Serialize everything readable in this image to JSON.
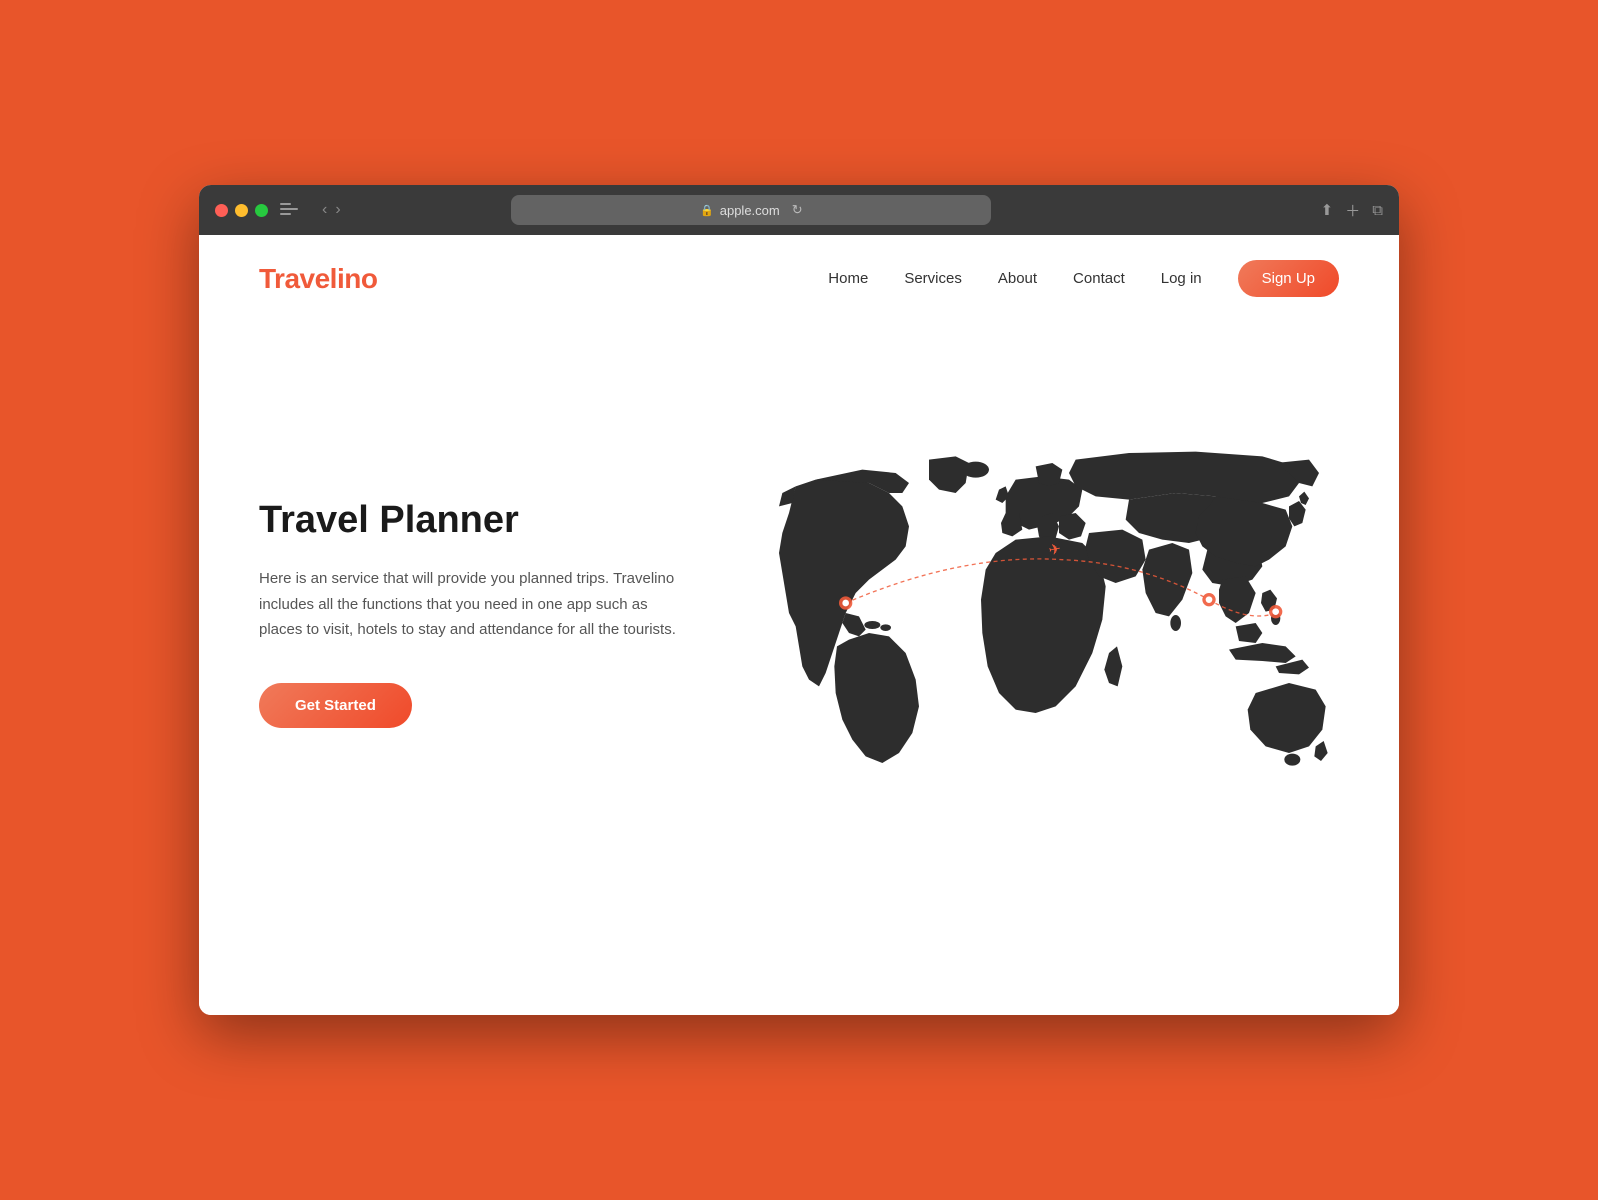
{
  "browser": {
    "url": "apple.com",
    "reload_title": "Reload page"
  },
  "navbar": {
    "logo": "Travelino",
    "links": [
      "Home",
      "Services",
      "About",
      "Contact",
      "Log in"
    ],
    "cta": "Sign Up"
  },
  "hero": {
    "title": "Travel Planner",
    "description": "Here is an service that will provide you planned trips. Travelino includes all the functions that you need in one app such as places to visit, hotels to stay and attendance for all the tourists.",
    "cta": "Get Started"
  },
  "colors": {
    "brand": "#F05A3A",
    "accent": "#E8552A",
    "dark": "#1a1a1a",
    "text": "#555555"
  }
}
